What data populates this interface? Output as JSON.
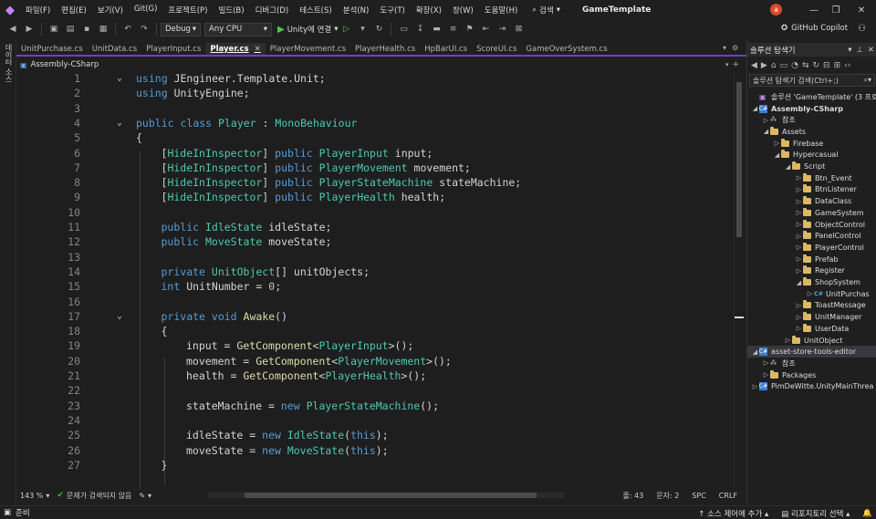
{
  "menubar": {
    "items": [
      "파일(F)",
      "편집(E)",
      "보기(V)",
      "Git(G)",
      "프로젝트(P)",
      "빌드(B)",
      "디버그(D)",
      "테스트(S)",
      "분석(N)",
      "도구(T)",
      "확장(X)",
      "창(W)",
      "도움말(H)"
    ],
    "search_label": "검색",
    "app_title": "GameTemplate",
    "avatar_letter": "a"
  },
  "toolbar": {
    "config": "Debug",
    "platform": "Any CPU",
    "run_label": "Unity에 연결",
    "copilot_label": "GitHub Copilot"
  },
  "left_strip_label": "데이터 소스",
  "tabs": [
    {
      "label": "UnitPurchase.cs",
      "active": false
    },
    {
      "label": "UnitData.cs",
      "active": false
    },
    {
      "label": "PlayerInput.cs",
      "active": false
    },
    {
      "label": "Player.cs",
      "active": true
    },
    {
      "label": "PlayerMovement.cs",
      "active": false
    },
    {
      "label": "PlayerHealth.cs",
      "active": false
    },
    {
      "label": "HpBarUI.cs",
      "active": false
    },
    {
      "label": "ScoreUI.cs",
      "active": false
    },
    {
      "label": "GameOverSystem.cs",
      "active": false
    }
  ],
  "navbar": {
    "assembly": "Assembly-CSharp"
  },
  "code_lines": [
    {
      "n": "1",
      "fold": "⌄",
      "indent": 0,
      "tokens": [
        [
          "kw",
          "using"
        ],
        [
          "",
          "JEngineer.Template.Unit;"
        ]
      ]
    },
    {
      "n": "2",
      "fold": "",
      "indent": 0,
      "tokens": [
        [
          "kw",
          "using"
        ],
        [
          "",
          "UnityEngine;"
        ]
      ]
    },
    {
      "n": "3",
      "fold": "",
      "indent": 0,
      "tokens": []
    },
    {
      "n": "4",
      "fold": "⌄",
      "indent": 0,
      "tokens": [
        [
          "kw",
          "public"
        ],
        [
          "kw",
          "class"
        ],
        [
          "ty",
          "Player"
        ],
        [
          "",
          ":"
        ],
        [
          "ty",
          "MonoBehaviour"
        ]
      ]
    },
    {
      "n": "5",
      "fold": "",
      "indent": 0,
      "tokens": [
        [
          "",
          "{"
        ]
      ]
    },
    {
      "n": "6",
      "fold": "",
      "indent": 1,
      "tokens": [
        [
          "",
          "["
        ],
        [
          "at",
          "HideInInspector"
        ],
        [
          "",
          "]"
        ],
        [
          "kw",
          "public"
        ],
        [
          "ty",
          "PlayerInput"
        ],
        [
          "",
          "input;"
        ]
      ]
    },
    {
      "n": "7",
      "fold": "",
      "indent": 1,
      "tokens": [
        [
          "",
          "["
        ],
        [
          "at",
          "HideInInspector"
        ],
        [
          "",
          "]"
        ],
        [
          "kw",
          "public"
        ],
        [
          "ty",
          "PlayerMovement"
        ],
        [
          "",
          "movement;"
        ]
      ]
    },
    {
      "n": "8",
      "fold": "",
      "indent": 1,
      "tokens": [
        [
          "",
          "["
        ],
        [
          "at",
          "HideInInspector"
        ],
        [
          "",
          "]"
        ],
        [
          "kw",
          "public"
        ],
        [
          "ty",
          "PlayerStateMachine"
        ],
        [
          "",
          "stateMachine;"
        ]
      ]
    },
    {
      "n": "9",
      "fold": "",
      "indent": 1,
      "tokens": [
        [
          "",
          "["
        ],
        [
          "at",
          "HideInInspector"
        ],
        [
          "",
          "]"
        ],
        [
          "kw",
          "public"
        ],
        [
          "ty",
          "PlayerHealth"
        ],
        [
          "",
          "health;"
        ]
      ]
    },
    {
      "n": "10",
      "fold": "",
      "indent": 0,
      "tokens": []
    },
    {
      "n": "11",
      "fold": "",
      "indent": 1,
      "tokens": [
        [
          "kw",
          "public"
        ],
        [
          "ty",
          "IdleState"
        ],
        [
          "",
          "idleState;"
        ]
      ]
    },
    {
      "n": "12",
      "fold": "",
      "indent": 1,
      "tokens": [
        [
          "kw",
          "public"
        ],
        [
          "ty",
          "MoveState"
        ],
        [
          "",
          "moveState;"
        ]
      ]
    },
    {
      "n": "13",
      "fold": "",
      "indent": 0,
      "tokens": []
    },
    {
      "n": "14",
      "fold": "",
      "indent": 1,
      "tokens": [
        [
          "kw",
          "private"
        ],
        [
          "ty",
          "UnitObject"
        ],
        [
          "",
          "[] unitObjects;"
        ]
      ]
    },
    {
      "n": "15",
      "fold": "",
      "indent": 1,
      "tokens": [
        [
          "kw",
          "int"
        ],
        [
          "",
          "UnitNumber ="
        ],
        [
          "num",
          "0"
        ],
        [
          "",
          ";"
        ]
      ]
    },
    {
      "n": "16",
      "fold": "",
      "indent": 0,
      "tokens": []
    },
    {
      "n": "17",
      "fold": "⌄",
      "indent": 1,
      "tokens": [
        [
          "kw",
          "private"
        ],
        [
          "kw",
          "void"
        ],
        [
          "fn",
          "Awake"
        ],
        [
          "",
          "()"
        ]
      ]
    },
    {
      "n": "18",
      "fold": "",
      "indent": 1,
      "tokens": [
        [
          "",
          "{"
        ]
      ]
    },
    {
      "n": "19",
      "fold": "",
      "indent": 2,
      "tokens": [
        [
          "",
          "input ="
        ],
        [
          "fn",
          "GetComponent"
        ],
        [
          "",
          "<"
        ],
        [
          "ty",
          "PlayerInput"
        ],
        [
          "",
          ">();"
        ]
      ]
    },
    {
      "n": "20",
      "fold": "",
      "indent": 2,
      "tokens": [
        [
          "",
          "movement ="
        ],
        [
          "fn",
          "GetComponent"
        ],
        [
          "",
          "<"
        ],
        [
          "ty",
          "PlayerMovement"
        ],
        [
          "",
          ">();"
        ]
      ]
    },
    {
      "n": "21",
      "fold": "",
      "indent": 2,
      "tokens": [
        [
          "",
          "health ="
        ],
        [
          "fn",
          "GetComponent"
        ],
        [
          "",
          "<"
        ],
        [
          "ty",
          "PlayerHealth"
        ],
        [
          "",
          ">();"
        ]
      ]
    },
    {
      "n": "22",
      "fold": "",
      "indent": 0,
      "tokens": []
    },
    {
      "n": "23",
      "fold": "",
      "indent": 2,
      "tokens": [
        [
          "",
          "stateMachine ="
        ],
        [
          "kw",
          "new"
        ],
        [
          "ty",
          "PlayerStateMachine"
        ],
        [
          "",
          "();"
        ]
      ]
    },
    {
      "n": "24",
      "fold": "",
      "indent": 0,
      "tokens": []
    },
    {
      "n": "25",
      "fold": "",
      "indent": 2,
      "tokens": [
        [
          "",
          "idleState ="
        ],
        [
          "kw",
          "new"
        ],
        [
          "ty",
          "IdleState"
        ],
        [
          "",
          "("
        ],
        [
          "kw",
          "this"
        ],
        [
          "",
          ");"
        ]
      ]
    },
    {
      "n": "26",
      "fold": "",
      "indent": 2,
      "tokens": [
        [
          "",
          "moveState ="
        ],
        [
          "kw",
          "new"
        ],
        [
          "ty",
          "MoveState"
        ],
        [
          "",
          "("
        ],
        [
          "kw",
          "this"
        ],
        [
          "",
          ");"
        ]
      ]
    },
    {
      "n": "27",
      "fold": "",
      "indent": 1,
      "tokens": [
        [
          "",
          "}"
        ]
      ]
    }
  ],
  "editor_status": {
    "zoom": "143 %",
    "issues": "문제가 검색되지 않음",
    "line": "줄: 43",
    "col": "문자: 2",
    "ws": "SPC",
    "eol": "CRLF"
  },
  "solution_explorer": {
    "title": "솔루션 탐색기",
    "search_placeholder": "솔루션 탐색기 검색(Ctrl+;)",
    "items": [
      {
        "label": "솔루션 'GameTemplate' (3 프로",
        "depth": 0,
        "icon": "sln",
        "exp": "",
        "selected": false
      },
      {
        "label": "Assembly-CSharp",
        "depth": 0,
        "icon": "proj",
        "exp": "◢",
        "selected": false,
        "bold": true
      },
      {
        "label": "참조",
        "depth": 1,
        "icon": "ref",
        "exp": "▷",
        "selected": false
      },
      {
        "label": "Assets",
        "depth": 1,
        "icon": "folder",
        "exp": "◢",
        "selected": false
      },
      {
        "label": "Firebase",
        "depth": 2,
        "icon": "folder",
        "exp": "▷",
        "selected": false
      },
      {
        "label": "Hypercasual",
        "depth": 2,
        "icon": "folder",
        "exp": "◢",
        "selected": false
      },
      {
        "label": "Script",
        "depth": 3,
        "icon": "folder",
        "exp": "◢",
        "selected": false
      },
      {
        "label": "Btn_Event",
        "depth": 4,
        "icon": "folder",
        "exp": "▷",
        "selected": false
      },
      {
        "label": "BtnListener",
        "depth": 4,
        "icon": "folder",
        "exp": "▷",
        "selected": false
      },
      {
        "label": "DataClass",
        "depth": 4,
        "icon": "folder",
        "exp": "▷",
        "selected": false
      },
      {
        "label": "GameSystem",
        "depth": 4,
        "icon": "folder",
        "exp": "▷",
        "selected": false
      },
      {
        "label": "ObjectControl",
        "depth": 4,
        "icon": "folder",
        "exp": "▷",
        "selected": false
      },
      {
        "label": "PanelControl",
        "depth": 4,
        "icon": "folder",
        "exp": "▷",
        "selected": false
      },
      {
        "label": "PlayerControl",
        "depth": 4,
        "icon": "folder",
        "exp": "▷",
        "selected": false
      },
      {
        "label": "Prefab",
        "depth": 4,
        "icon": "folder",
        "exp": "▷",
        "selected": false
      },
      {
        "label": "Register",
        "depth": 4,
        "icon": "folder",
        "exp": "▷",
        "selected": false
      },
      {
        "label": "ShopSystem",
        "depth": 4,
        "icon": "folder",
        "exp": "◢",
        "selected": false
      },
      {
        "label": "UnitPurchas",
        "depth": 5,
        "icon": "cs",
        "exp": "▷",
        "selected": false
      },
      {
        "label": "ToastMessage",
        "depth": 4,
        "icon": "folder",
        "exp": "▷",
        "selected": false
      },
      {
        "label": "UnitManager",
        "depth": 4,
        "icon": "folder",
        "exp": "▷",
        "selected": false
      },
      {
        "label": "UserData",
        "depth": 4,
        "icon": "folder",
        "exp": "▷",
        "selected": false
      },
      {
        "label": "UnitObject",
        "depth": 3,
        "icon": "folder",
        "exp": "▷",
        "selected": false
      },
      {
        "label": "asset-store-tools-editor",
        "depth": 0,
        "icon": "proj",
        "exp": "◢",
        "selected": true
      },
      {
        "label": "참조",
        "depth": 1,
        "icon": "ref",
        "exp": "▷",
        "selected": false
      },
      {
        "label": "Packages",
        "depth": 1,
        "icon": "folder",
        "exp": "▷",
        "selected": false
      },
      {
        "label": "PimDeWitte.UnityMainThrea",
        "depth": 0,
        "icon": "proj",
        "exp": "▷",
        "selected": false
      }
    ]
  },
  "statusbar": {
    "ready": "준비",
    "add_source": "소스 제어에 추가",
    "select_repo": "리포지토리 선택"
  }
}
